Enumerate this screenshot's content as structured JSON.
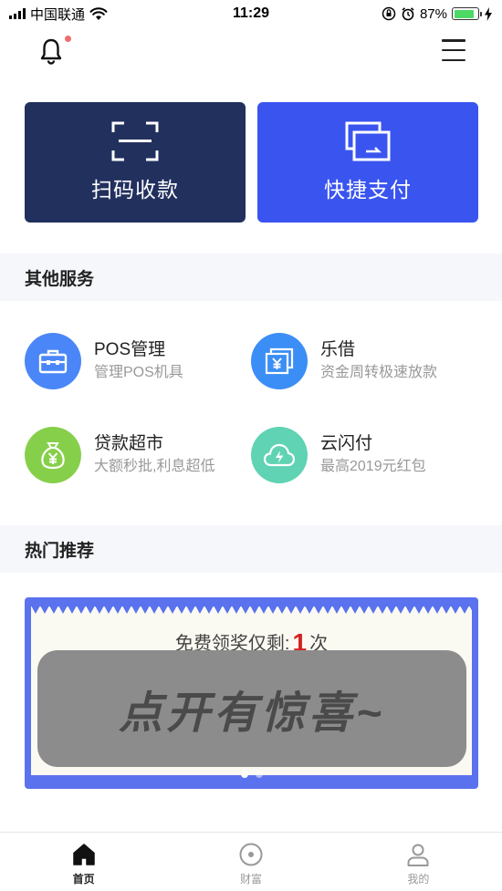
{
  "status_bar": {
    "carrier": "中国联通",
    "time": "11:29",
    "battery": "87%",
    "battery_level": 0.87
  },
  "header": {
    "notification_icon": "bell-icon",
    "menu_icon": "hamburger-menu-icon",
    "has_unread": true
  },
  "actions": [
    {
      "label": "扫码收款",
      "icon": "scan-icon",
      "color": "#22305e"
    },
    {
      "label": "快捷支付",
      "icon": "quick-pay-icon",
      "color": "#3a54f0"
    }
  ],
  "services_section": {
    "title": "其他服务",
    "items": [
      {
        "title": "POS管理",
        "subtitle": "管理POS机具",
        "icon": "toolbox-icon",
        "color": "#4a86f7"
      },
      {
        "title": "乐借",
        "subtitle": "资金周转极速放款",
        "icon": "yen-cards-icon",
        "color": "#3b8ef5"
      },
      {
        "title": "贷款超市",
        "subtitle": "大额秒批,利息超低",
        "icon": "money-bag-icon",
        "color": "#86cf4b"
      },
      {
        "title": "云闪付",
        "subtitle": "最高2019元红包",
        "icon": "cloud-flash-icon",
        "color": "#5fd3b3"
      }
    ]
  },
  "hot_section": {
    "title": "热门推荐",
    "banner": {
      "prefix": "免费领奖仅剩:",
      "count": "1",
      "suffix": "次",
      "scratch_text": "点开有惊喜~",
      "page_count": 2,
      "active_page": 0
    }
  },
  "tabs": [
    {
      "label": "首页",
      "icon": "home-icon",
      "active": true
    },
    {
      "label": "财富",
      "icon": "compass-icon",
      "active": false
    },
    {
      "label": "我的",
      "icon": "user-icon",
      "active": false
    }
  ]
}
